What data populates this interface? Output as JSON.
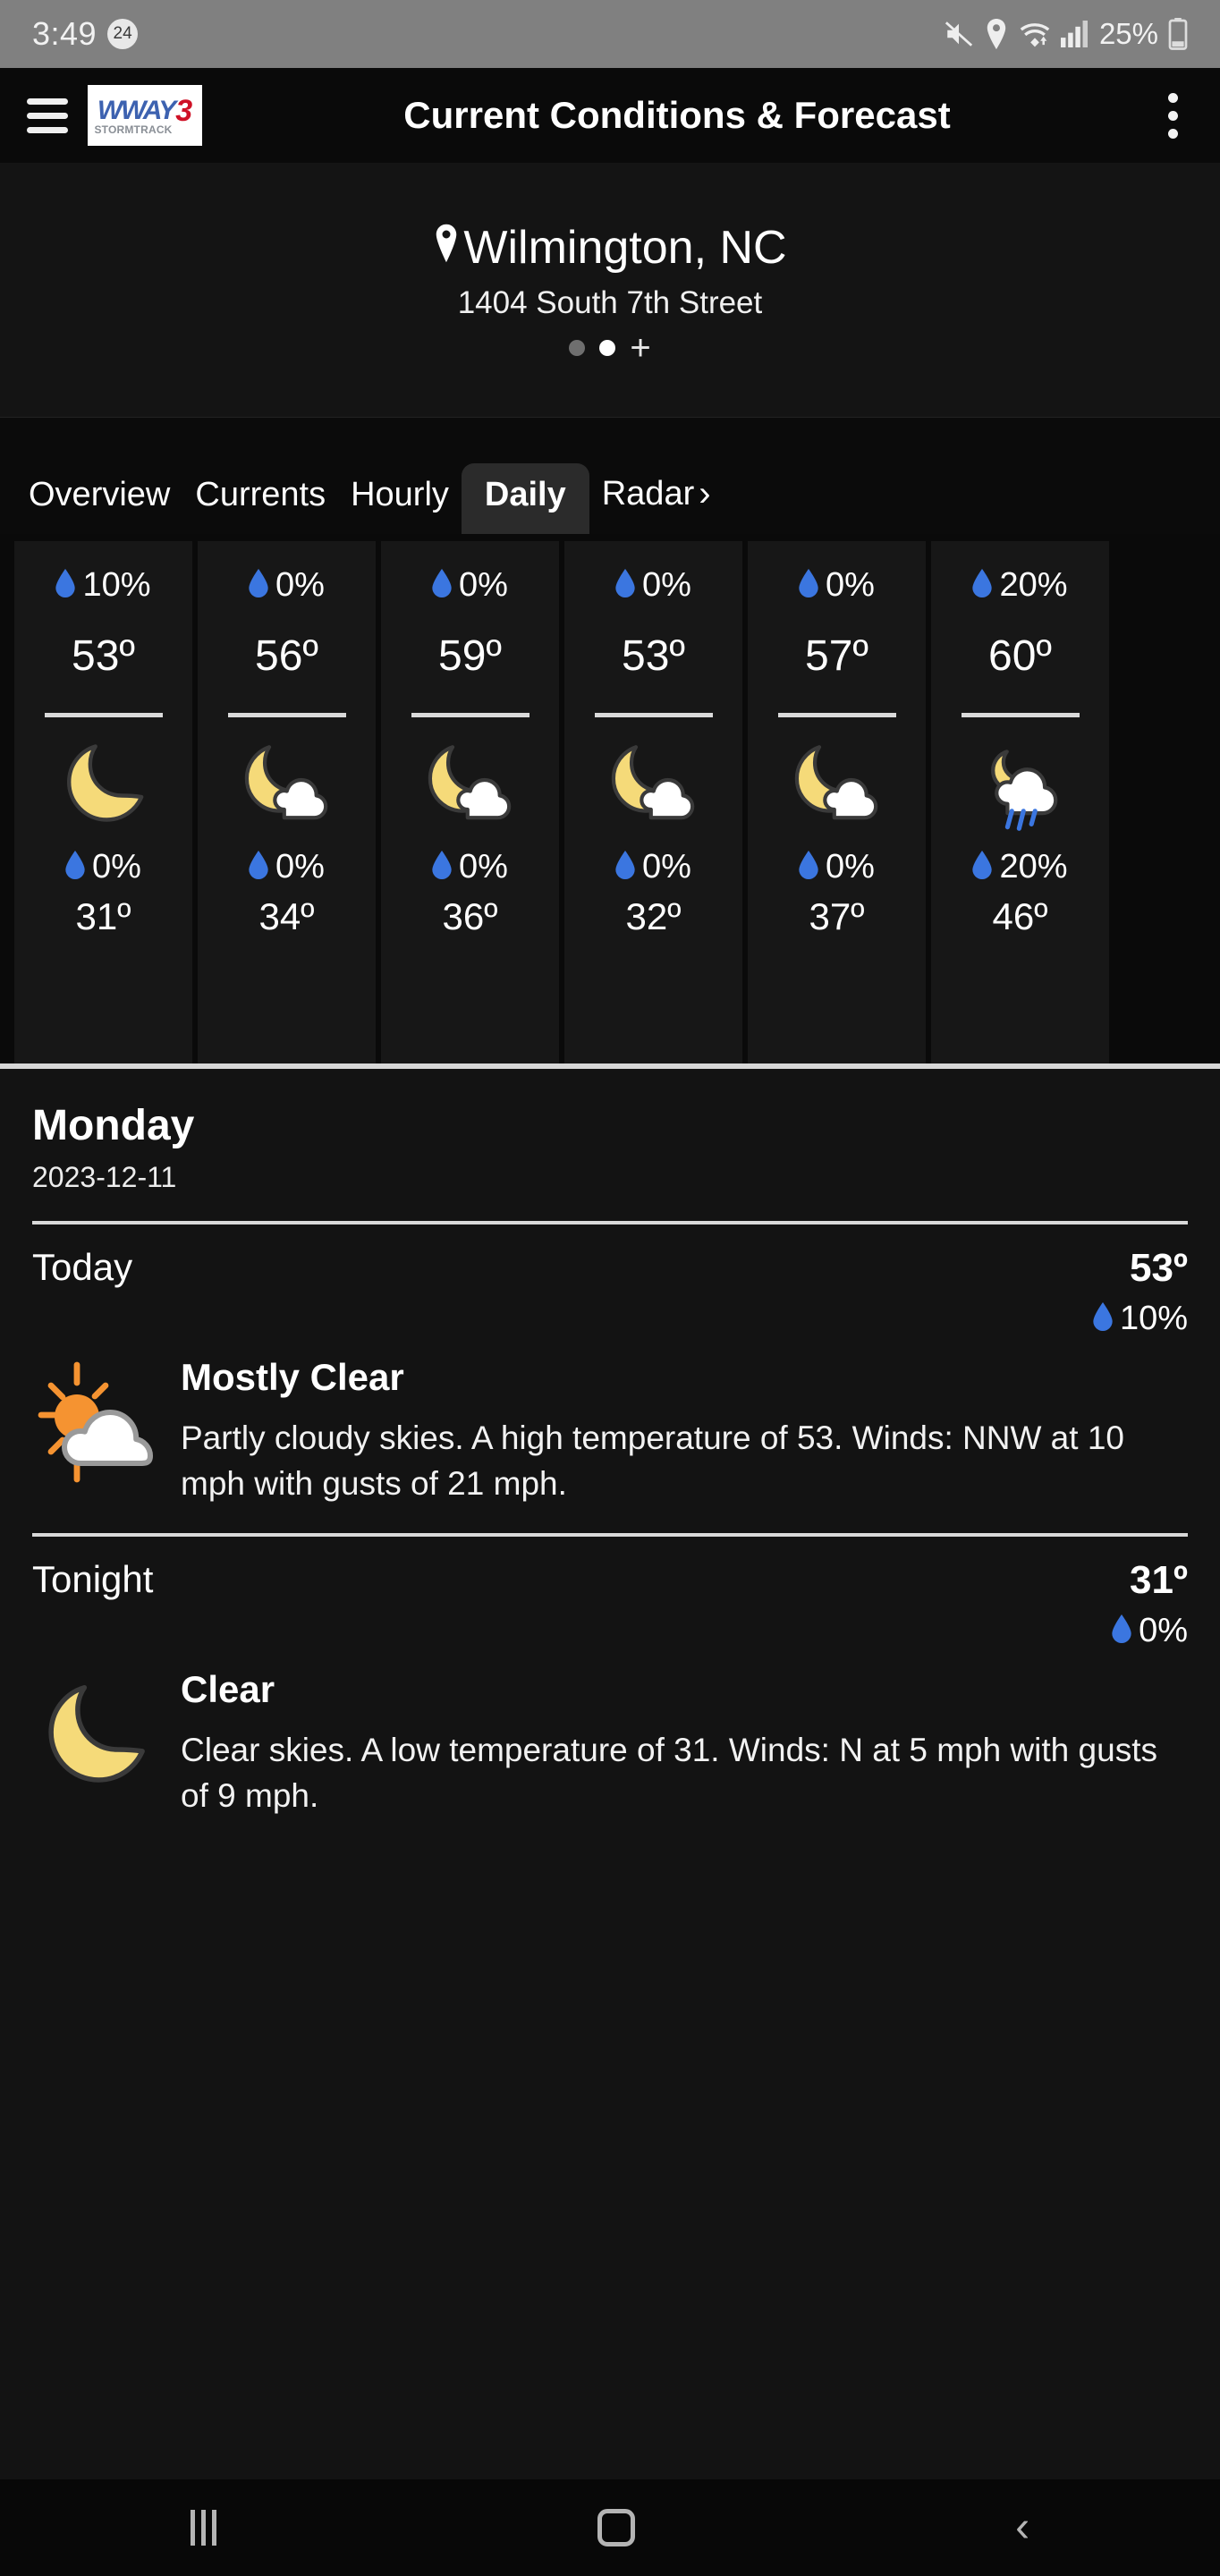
{
  "statusbar": {
    "time": "3:49",
    "notification_count": "24",
    "battery_percent": "25%",
    "icons": [
      "mute-icon",
      "location-icon",
      "wifi-icon",
      "signal-icon",
      "battery-icon"
    ]
  },
  "appbar": {
    "menu_icon": "hamburger-icon",
    "logo_primary": "WWAY",
    "logo_channel": "3",
    "logo_secondary": "STORMTRACK",
    "title": "Current Conditions & Forecast",
    "overflow_icon": "kebab-menu-icon"
  },
  "location": {
    "city": "Wilmington, NC",
    "address": "1404 South 7th Street",
    "pin_icon": "location-pin-icon",
    "pager": {
      "dots": 2,
      "active_index": 1,
      "add_label": "+"
    }
  },
  "tabs": {
    "items": [
      {
        "label": "Overview",
        "active": false
      },
      {
        "label": "Currents",
        "active": false
      },
      {
        "label": "Hourly",
        "active": false
      },
      {
        "label": "Daily",
        "active": true
      },
      {
        "label": "Radar",
        "active": false,
        "chevron": "›"
      }
    ]
  },
  "forecast_strip": {
    "columns": [
      {
        "day_pop": "10%",
        "high": "53º",
        "night_icon": "moon-icon",
        "night_pop": "0%",
        "low": "31º"
      },
      {
        "day_pop": "0%",
        "high": "56º",
        "night_icon": "moon-cloud-icon",
        "night_pop": "0%",
        "low": "34º"
      },
      {
        "day_pop": "0%",
        "high": "59º",
        "night_icon": "moon-cloud-icon",
        "night_pop": "0%",
        "low": "36º"
      },
      {
        "day_pop": "0%",
        "high": "53º",
        "night_icon": "moon-cloud-icon",
        "night_pop": "0%",
        "low": "32º"
      },
      {
        "day_pop": "0%",
        "high": "57º",
        "night_icon": "moon-cloud-icon",
        "night_pop": "0%",
        "low": "37º"
      },
      {
        "day_pop": "20%",
        "high": "60º",
        "night_icon": "moon-cloud-rain-icon",
        "night_pop": "20%",
        "low": "46º"
      }
    ]
  },
  "detail": {
    "day_name": "Monday",
    "date": "2023-12-11",
    "periods": [
      {
        "label": "Today",
        "temp": "53º",
        "pop": "10%",
        "icon": "sun-cloud-icon",
        "condition": "Mostly Clear",
        "description": "Partly cloudy skies. A high temperature of 53. Winds: NNW at 10 mph with gusts of 21 mph."
      },
      {
        "label": "Tonight",
        "temp": "31º",
        "pop": "0%",
        "icon": "moon-icon",
        "condition": "Clear",
        "description": "Clear skies. A low temperature of 31. Winds: N at 5 mph with gusts of 9 mph."
      }
    ]
  },
  "navbar": {
    "recents_icon": "recents-icon",
    "home_icon": "home-icon",
    "back_icon": "back-icon"
  },
  "colors": {
    "accent_precip": "#3b76e0",
    "logo_blue": "#3d62b0",
    "logo_red": "#cf1126",
    "moon_yellow": "#f5da79",
    "sun_orange": "#f59331",
    "background": "#131313"
  }
}
